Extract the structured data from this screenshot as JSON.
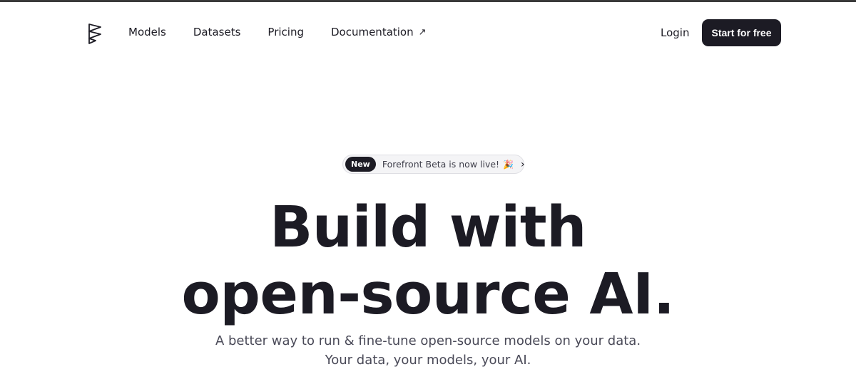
{
  "nav": {
    "logo_icon": "forefront-logo-icon",
    "links": [
      "Models",
      "Datasets",
      "Pricing",
      "Documentation"
    ],
    "external_icon": "↗",
    "login": "Login",
    "cta": "Start for free"
  },
  "hero": {
    "badge": "New",
    "announcement": "Forefront Beta is now live!",
    "announcement_emoji": "🎉",
    "announcement_chevron": "›",
    "headline_line1": "Build with",
    "headline_line2": "open-source AI.",
    "subtitle_line1": "A better way to run & fine-tune open-source models on your data.",
    "subtitle_line2": "Your data, your models, your AI."
  },
  "colors": {
    "primary": "#1c1b24",
    "pill_bg": "#f4f4f6",
    "subtitle": "#4a4a58"
  }
}
